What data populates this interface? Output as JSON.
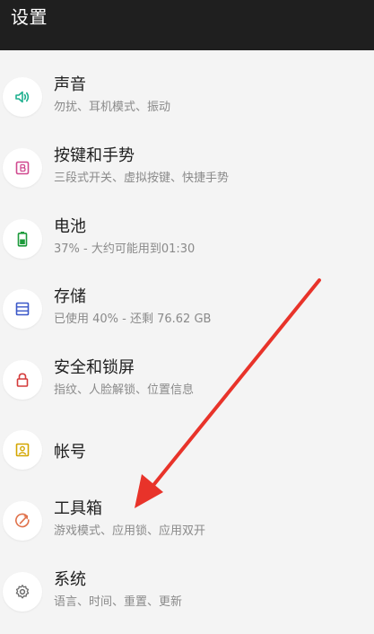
{
  "appbar": {
    "title": "设置"
  },
  "colors": {
    "sound": "#1fb08f",
    "buttons": "#d0498f",
    "battery": "#1c9a3a",
    "storage": "#3b58c8",
    "security": "#d43a3a",
    "account": "#d3a600",
    "toolbox": "#e0714a",
    "system": "#6b6b6b",
    "arrow": "#e8332a"
  },
  "items": [
    {
      "title": "声音",
      "subtitle": "勿扰、耳机模式、振动",
      "icon": "speaker-icon"
    },
    {
      "title": "按键和手势",
      "subtitle": "三段式开关、虚拟按键、快捷手势",
      "icon": "button-b-icon"
    },
    {
      "title": "电池",
      "subtitle": "37% - 大约可能用到01:30",
      "icon": "battery-icon"
    },
    {
      "title": "存储",
      "subtitle": "已使用 40% - 还剩 76.62 GB",
      "icon": "storage-icon"
    },
    {
      "title": "安全和锁屏",
      "subtitle": "指纹、人脸解锁、位置信息",
      "icon": "lock-icon"
    },
    {
      "title": "帐号",
      "subtitle": "",
      "icon": "account-icon"
    },
    {
      "title": "工具箱",
      "subtitle": "游戏模式、应用锁、应用双开",
      "icon": "toolbox-icon"
    },
    {
      "title": "系统",
      "subtitle": "语言、时间、重置、更新",
      "icon": "gear-icon"
    }
  ]
}
